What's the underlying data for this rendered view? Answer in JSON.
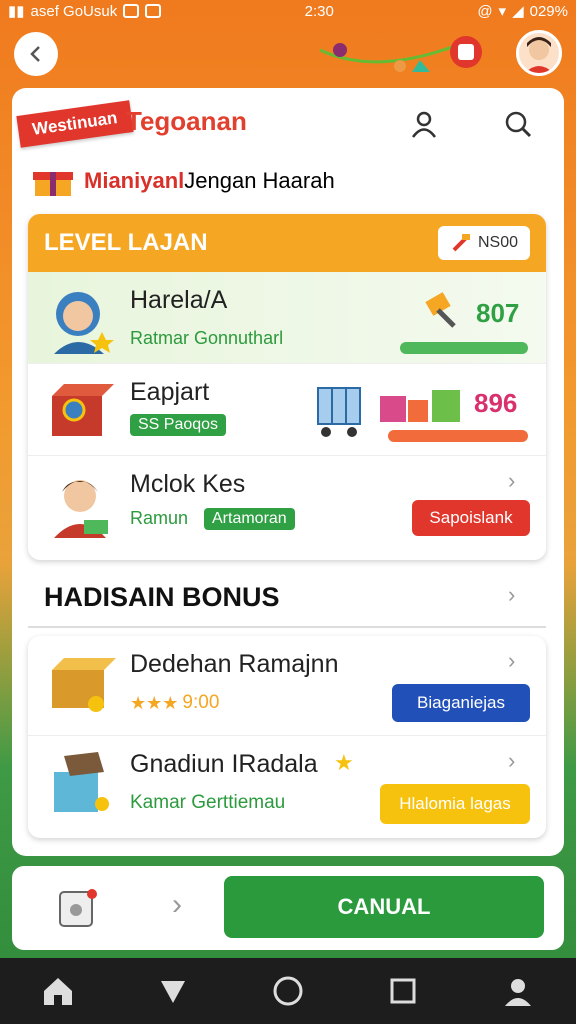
{
  "status_bar": {
    "carrier": "asef GoUsuk",
    "time": "2:30",
    "battery": "029%"
  },
  "header": {
    "ribbon": "Westinuan",
    "title": "Tegoanan"
  },
  "subtitle": {
    "highlight": "Mianiyanl",
    "rest": "Jengan Haarah"
  },
  "level": {
    "title": "LEVEL LAJAN",
    "badge": "NS00",
    "rows": [
      {
        "name": "Harela/A",
        "sub": "Ratmar Gonnutharl",
        "score": "807"
      },
      {
        "name": "Eapjart",
        "tag": "SS Paoqos",
        "score": "896"
      },
      {
        "name": "Mclok Kes",
        "sub": "Ramun",
        "tag": "Artamoran",
        "button": "Sapoislank"
      }
    ]
  },
  "bonus": {
    "title": "HADISAIN BONUS",
    "rows": [
      {
        "name": "Dedehan Ramajnn",
        "stars_text": "9:00",
        "button": "Biaganiejas"
      },
      {
        "name": "Gnadiun IRadala",
        "sub": "Kamar Gerttiemau",
        "button": "Hlalomia lagas"
      }
    ]
  },
  "footer": {
    "cta": "CANUAL"
  },
  "colors": {
    "orange": "#f5a623",
    "green": "#2fa043",
    "red": "#e0362c",
    "blue": "#2050b8",
    "yellow": "#f6c20e"
  },
  "icons": [
    "back-icon",
    "user-icon",
    "search-icon",
    "home-icon",
    "triangle-icon",
    "circle-icon",
    "square-icon",
    "profile-icon"
  ]
}
